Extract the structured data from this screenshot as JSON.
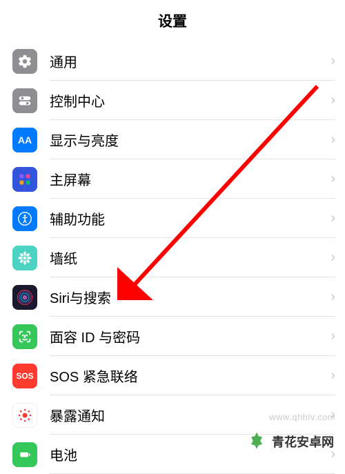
{
  "header": {
    "title": "设置"
  },
  "items": [
    {
      "label": "通用",
      "icon": "general"
    },
    {
      "label": "控制中心",
      "icon": "control"
    },
    {
      "label": "显示与亮度",
      "icon": "display"
    },
    {
      "label": "主屏幕",
      "icon": "home"
    },
    {
      "label": "辅助功能",
      "icon": "accessibility"
    },
    {
      "label": "墙纸",
      "icon": "wallpaper"
    },
    {
      "label": "Siri与搜索",
      "icon": "siri"
    },
    {
      "label": "面容 ID 与密码",
      "icon": "faceid"
    },
    {
      "label": "SOS 紧急联络",
      "icon": "sos"
    },
    {
      "label": "暴露通知",
      "icon": "exposure"
    },
    {
      "label": "电池",
      "icon": "battery"
    }
  ],
  "sos_text": "SOS",
  "watermark": {
    "url": "www.qhhlv.com",
    "brand": "青花安卓网"
  }
}
